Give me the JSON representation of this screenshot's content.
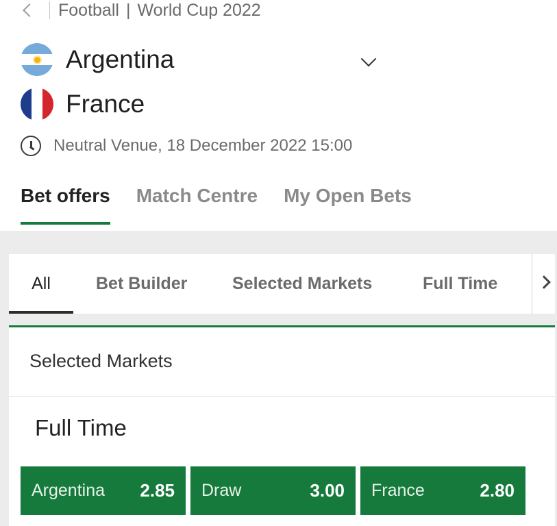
{
  "breadcrumb": {
    "sport": "Football",
    "separator": "|",
    "competition": "World Cup 2022"
  },
  "teams": {
    "home": "Argentina",
    "away": "France"
  },
  "venue": "Neutral Venue, 18 December 2022 15:00",
  "main_tabs": [
    {
      "label": "Bet offers",
      "active": true
    },
    {
      "label": "Match Centre",
      "active": false
    },
    {
      "label": "My Open Bets",
      "active": false
    }
  ],
  "sub_tabs": [
    {
      "label": "All",
      "active": true
    },
    {
      "label": "Bet Builder",
      "active": false
    },
    {
      "label": "Selected Markets",
      "active": false
    },
    {
      "label": "Full Time",
      "active": false
    }
  ],
  "section_title": "Selected Markets",
  "market": {
    "title": "Full Time",
    "outcomes": [
      {
        "label": "Argentina",
        "price": "2.85"
      },
      {
        "label": "Draw",
        "price": "3.00"
      },
      {
        "label": "France",
        "price": "2.80"
      }
    ]
  },
  "colors": {
    "brand_green": "#157a3c",
    "panel_bg": "#ececec",
    "argentina_blue": "#75aadb",
    "france_blue": "#1e3c8c",
    "france_red": "#d3262d"
  },
  "icons": {
    "back": "chevron-left-icon",
    "expand": "chevron-down-icon",
    "time": "clock-icon",
    "scroll": "chevron-right-icon"
  }
}
